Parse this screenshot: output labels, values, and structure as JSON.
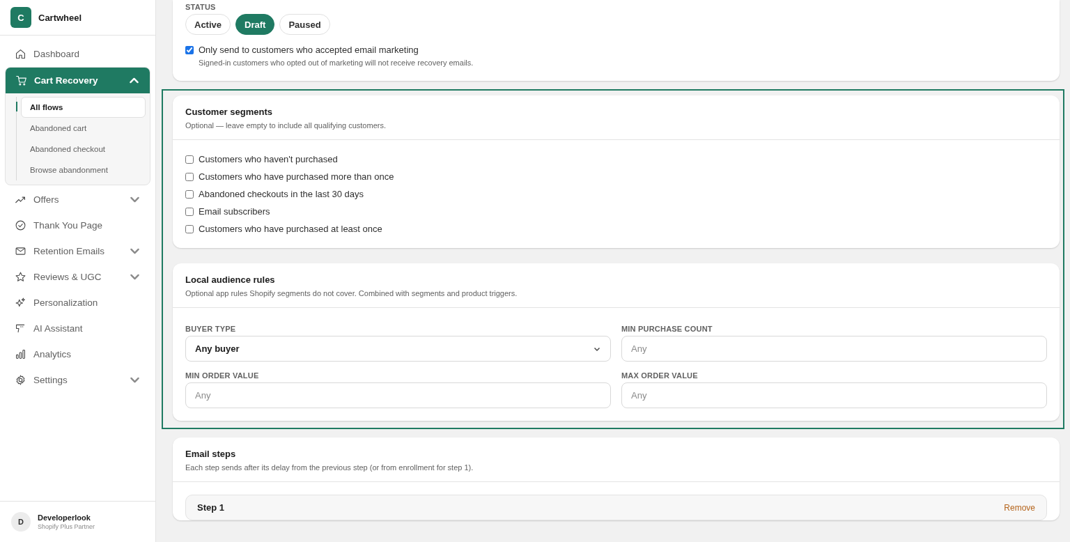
{
  "sidebar": {
    "brand": {
      "initial": "C",
      "name": "Cartwheel"
    },
    "items": [
      {
        "label": "Dashboard",
        "selected": false,
        "expandable": false
      },
      {
        "label": "Cart Recovery",
        "selected": true,
        "expandable": true,
        "expanded": true,
        "children": [
          {
            "label": "All flows",
            "selected": true
          },
          {
            "label": "Abandoned cart",
            "selected": false
          },
          {
            "label": "Abandoned checkout",
            "selected": false
          },
          {
            "label": "Browse abandonment",
            "selected": false
          }
        ]
      },
      {
        "label": "Offers",
        "selected": false,
        "expandable": true,
        "expanded": false
      },
      {
        "label": "Thank You Page",
        "selected": false,
        "expandable": false
      },
      {
        "label": "Retention Emails",
        "selected": false,
        "expandable": true,
        "expanded": false
      },
      {
        "label": "Reviews & UGC",
        "selected": false,
        "expandable": true,
        "expanded": false
      },
      {
        "label": "Personalization",
        "selected": false,
        "expandable": false
      },
      {
        "label": "AI Assistant",
        "selected": false,
        "expandable": false
      },
      {
        "label": "Analytics",
        "selected": false,
        "expandable": false
      },
      {
        "label": "Settings",
        "selected": false,
        "expandable": true,
        "expanded": false
      }
    ],
    "user": {
      "initial": "D",
      "name": "Developerlook",
      "role": "Shopify Plus Partner"
    }
  },
  "status": {
    "label": "STATUS",
    "options": [
      {
        "label": "Active",
        "selected": false
      },
      {
        "label": "Draft",
        "selected": true
      },
      {
        "label": "Paused",
        "selected": false
      }
    ],
    "consent": {
      "label": "Only send to customers who accepted email marketing",
      "checked": true,
      "hint": "Signed-in customers who opted out of marketing will not receive recovery emails."
    }
  },
  "segments": {
    "title": "Customer segments",
    "subtitle": "Optional — leave empty to include all qualifying customers.",
    "options": [
      {
        "label": "Customers who haven't purchased",
        "checked": false
      },
      {
        "label": "Customers who have purchased more than once",
        "checked": false
      },
      {
        "label": "Abandoned checkouts in the last 30 days",
        "checked": false
      },
      {
        "label": "Email subscribers",
        "checked": false
      },
      {
        "label": "Customers who have purchased at least once",
        "checked": false
      }
    ]
  },
  "rules": {
    "title": "Local audience rules",
    "subtitle": "Optional app rules Shopify segments do not cover. Combined with segments and product triggers.",
    "fields": [
      {
        "kind": "select",
        "label": "BUYER TYPE",
        "value": "Any buyer"
      },
      {
        "kind": "input",
        "label": "MIN PURCHASE COUNT",
        "placeholder": "Any"
      },
      {
        "kind": "input",
        "label": "MIN ORDER VALUE",
        "placeholder": "Any"
      },
      {
        "kind": "input",
        "label": "MAX ORDER VALUE",
        "placeholder": "Any"
      }
    ]
  },
  "email_steps": {
    "title": "Email steps",
    "subtitle": "Each step sends after its delay from the previous step (or from enrollment for step 1).",
    "steps": [
      {
        "title": "Step 1",
        "action": "Remove"
      }
    ]
  }
}
